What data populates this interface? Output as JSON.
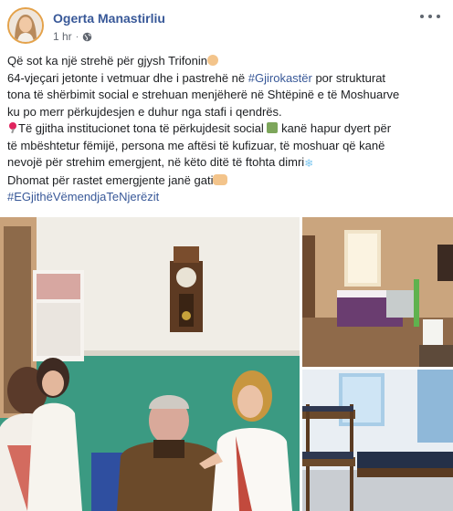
{
  "post": {
    "author": "Ogerta Manastirliu",
    "time": "1 hr",
    "separator": "·",
    "privacy_icon": "globe-icon",
    "more_icon": "more-options-icon"
  },
  "text": {
    "l1": "Që sot ka një strehë për gjysh Trifonin",
    "l2a": "64-vjeçari jetonte i vetmuar dhe i pastrehë në ",
    "l2_tag": "#Gjirokastër",
    "l2b": " por strukturat",
    "l3": "tona të shërbimit social e strehuan menjëherë në Shtëpinë e të Moshuarve",
    "l4": "ku po merr përkujdesjen e duhur nga stafi i qendrës.",
    "l5a": "Të gjitha institucionet tona të përkujdesit social",
    "l5b": " kanë hapur dyert për",
    "l6": "të mbështetur fëmijë, persona me aftësi të kufizuar, të moshuar që kanë",
    "l7": "nevojë për strehim emergjent, në këto ditë të ftohta dimri",
    "l8": "Dhomat për rastet emergjente janë gati",
    "tag2": "#EGjithëVëmendjaTeNjerëzit",
    "snow_glyph": "❄"
  },
  "icons": {
    "l1_end": "old-man-emoji-icon",
    "l5_start": "pushpin-emoji-icon",
    "l5_mid": "house-with-garden-emoji-icon",
    "l7_end": "snowflake-emoji-icon",
    "l8_end": "raised-hands-emoji-icon"
  },
  "colors": {
    "link": "#385898",
    "text": "#1c1e21",
    "meta": "#616770",
    "avatar_ring": "#e4a24a"
  }
}
